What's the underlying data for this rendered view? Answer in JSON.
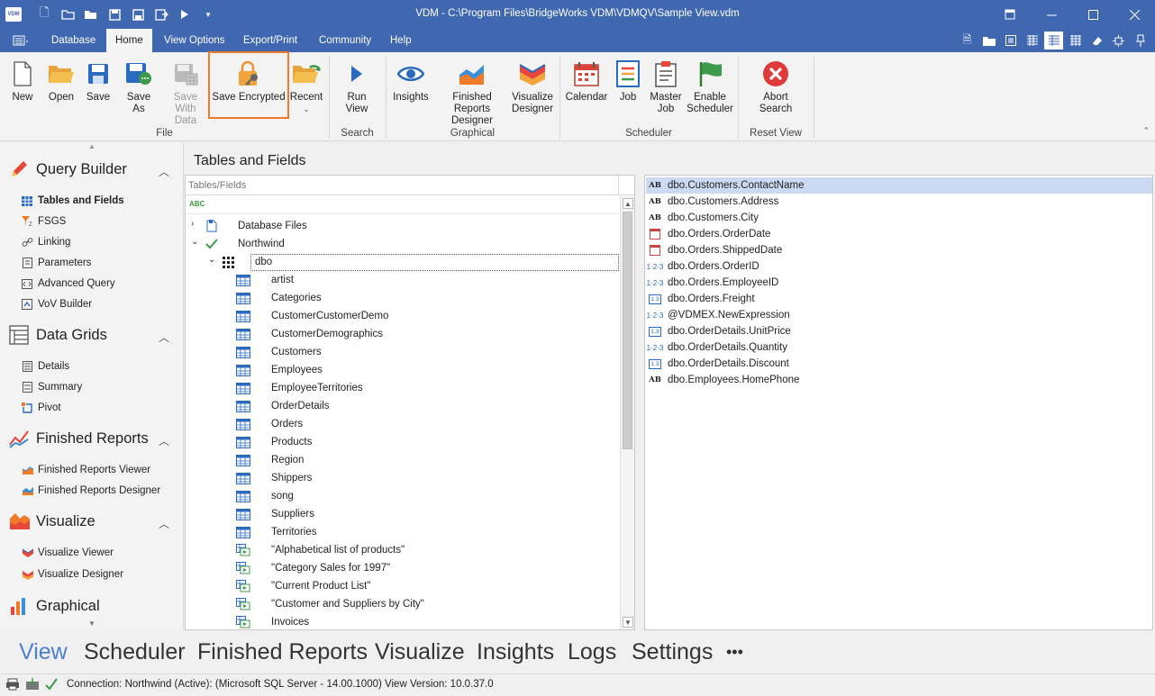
{
  "window": {
    "title": "VDM - C:\\Program Files\\BridgeWorks VDM\\VDMQV\\Sample View.vdm",
    "app_icon_text": "VDM"
  },
  "menu_tabs": [
    "Database",
    "Home",
    "View Options",
    "Export/Print",
    "Community",
    "Help"
  ],
  "ribbon": {
    "file": {
      "label": "File",
      "buttons": {
        "new": "New",
        "open": "Open",
        "save": "Save",
        "save_as": "Save As",
        "save_with_data_1": "Save With",
        "save_with_data_2": "Data",
        "save_encrypted": "Save Encrypted",
        "recent": "Recent"
      }
    },
    "search": {
      "label": "Search",
      "run_view": "Run View"
    },
    "graphical": {
      "label": "Graphical",
      "insights": "Insights",
      "frd_1": "Finished Reports",
      "frd_2": "Designer",
      "vd_1": "Visualize",
      "vd_2": "Designer"
    },
    "scheduler": {
      "label": "Scheduler",
      "calendar": "Calendar",
      "job": "Job",
      "master_job_1": "Master",
      "master_job_2": "Job",
      "enable_1": "Enable",
      "enable_2": "Scheduler"
    },
    "reset_view": {
      "label": "Reset View",
      "abort_1": "Abort",
      "abort_2": "Search"
    }
  },
  "sidebar": {
    "query_builder": {
      "title": "Query Builder",
      "items": [
        "Tables and Fields",
        "FSGS",
        "Linking",
        "Parameters",
        "Advanced Query",
        "VoV Builder"
      ]
    },
    "data_grids": {
      "title": "Data Grids",
      "items": [
        "Details",
        "Summary",
        "Pivot"
      ]
    },
    "finished_reports": {
      "title": "Finished Reports",
      "items": [
        "Finished Reports Viewer",
        "Finished Reports Designer"
      ]
    },
    "visualize": {
      "title": "Visualize",
      "items": [
        "Visualize Viewer",
        "Visualize Designer"
      ]
    },
    "graphical": {
      "title": "Graphical"
    }
  },
  "main": {
    "title": "Tables and Fields",
    "tree_header": "Tables/Fields",
    "filter_icon_text": "ABC",
    "tree": {
      "database_files": "Database Files",
      "northwind": "Northwind",
      "dbo": "dbo",
      "tables": [
        "artist",
        "Categories",
        "CustomerCustomerDemo",
        "CustomerDemographics",
        "Customers",
        "Employees",
        "EmployeeTerritories",
        "OrderDetails",
        "Orders",
        "Products",
        "Region",
        "Shippers",
        "song",
        "Suppliers",
        "Territories"
      ],
      "views": [
        "\"Alphabetical list of products\"",
        "\"Category Sales for 1997\"",
        "\"Current Product List\"",
        "\"Customer and Suppliers by City\"",
        "Invoices"
      ]
    },
    "fields": [
      {
        "name": "dbo.Customers.ContactName",
        "type": "text"
      },
      {
        "name": "dbo.Customers.Address",
        "type": "text"
      },
      {
        "name": "dbo.Customers.City",
        "type": "text"
      },
      {
        "name": "dbo.Orders.OrderDate",
        "type": "date"
      },
      {
        "name": "dbo.Orders.ShippedDate",
        "type": "date"
      },
      {
        "name": "dbo.Orders.OrderID",
        "type": "int"
      },
      {
        "name": "dbo.Orders.EmployeeID",
        "type": "int"
      },
      {
        "name": "dbo.Orders.Freight",
        "type": "decimal"
      },
      {
        "name": "@VDMEX.NewExpression",
        "type": "int"
      },
      {
        "name": "dbo.OrderDetails.UnitPrice",
        "type": "decimal"
      },
      {
        "name": "dbo.OrderDetails.Quantity",
        "type": "int"
      },
      {
        "name": "dbo.OrderDetails.Discount",
        "type": "decimal"
      },
      {
        "name": "dbo.Employees.HomePhone",
        "type": "text"
      }
    ],
    "field_type_icons": {
      "text": "AB",
      "int": "1·2·3",
      "decimal": "1.3"
    }
  },
  "bottom_nav": [
    "View",
    "Scheduler",
    "Finished Reports",
    "Visualize",
    "Insights",
    "Logs",
    "Settings",
    "•••"
  ],
  "status": {
    "text": "Connection: Northwind (Active): (Microsoft SQL Server - 14.00.1000) View Version: 10.0.37.0"
  },
  "colors": {
    "title_bar": "#3f68b1",
    "highlight_outline": "#f07a27",
    "nav_active": "#4d7fcf",
    "selected_row": "#cbd9f3"
  }
}
